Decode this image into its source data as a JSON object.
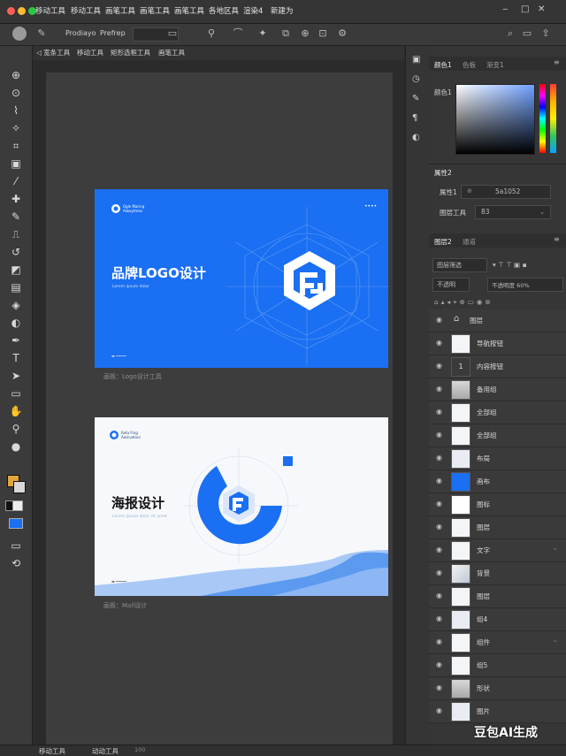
{
  "menubar": {
    "items": [
      "移动工具",
      "移动工具",
      "画笔工具",
      "画笔工具",
      "画笔工具",
      "各地区具",
      "渲染4",
      "新建为"
    ],
    "window_controls": [
      "‒",
      "□",
      "✕"
    ]
  },
  "options": {
    "preset_label": "Prodiayo",
    "preset_value": "Prefrep"
  },
  "tabs": [
    "◁ 宽条工具",
    "移动工具",
    "矩形选框工具",
    "画笔工具"
  ],
  "artboards": [
    {
      "title": "品牌LOGO设计",
      "subtitle": "Lorem ipsum dolor",
      "small_brand": "Ogle Maring\nAlwaytrens",
      "dots": "••••",
      "caption": "画板：Logo设计工具",
      "bottom_mark": "▬ ━━━━━"
    },
    {
      "title": "海报设计",
      "subtitle": "Lorem ipsum dolor sit amet",
      "small_brand": "Reta Frog\nAwinvation",
      "bottom_mark": "▬ ━━━━━",
      "caption": "画板：Mall设计",
      "square_color": "#1a6ff2"
    }
  ],
  "statusbar": {
    "left_text": "移动工具",
    "mid_text": "动动工具",
    "zoom_text": "100"
  },
  "panel_color": {
    "tabs": [
      "颜色1",
      "色板",
      "渐变1"
    ],
    "label": "颜色1"
  },
  "panel_props": {
    "header": "属性2",
    "row1_label": "属性1",
    "row1_value": "5a1052",
    "row2_label": "图层工具",
    "row2_value": "83"
  },
  "panel_layers": {
    "tabs": [
      "图层2",
      "通道"
    ],
    "filter_label": "图层筛选",
    "blend_label": "不透明",
    "blend_value": "不透明度 60%",
    "group_label": "图层",
    "layers": [
      {
        "name": "导航按钮",
        "thumb": "doc"
      },
      {
        "name": "内容按钮",
        "thumb": "num"
      },
      {
        "name": "备用组",
        "thumb": "gray"
      },
      {
        "name": "全部组",
        "thumb": "doc"
      },
      {
        "name": "全部组",
        "thumb": "doc"
      },
      {
        "name": "布局",
        "thumb": "light"
      },
      {
        "name": "画布",
        "thumb": "blue"
      },
      {
        "name": "图标",
        "thumb": "logo"
      },
      {
        "name": "图层",
        "thumb": "doc"
      },
      {
        "name": "文字",
        "thumb": "doc"
      },
      {
        "name": "背景",
        "thumb": "map"
      },
      {
        "name": "图层",
        "thumb": "doc"
      },
      {
        "name": "组4",
        "thumb": "light"
      },
      {
        "name": "组件",
        "thumb": "doc"
      },
      {
        "name": "组5",
        "thumb": "doc"
      },
      {
        "name": "形状",
        "thumb": "gray"
      },
      {
        "name": "图片",
        "thumb": "light"
      }
    ]
  },
  "watermark": "豆包AI生成",
  "colors": {
    "accent_blue": "#1a6ff2",
    "panel_bg": "#363636",
    "toolbar_bg": "#3b3b3b"
  }
}
